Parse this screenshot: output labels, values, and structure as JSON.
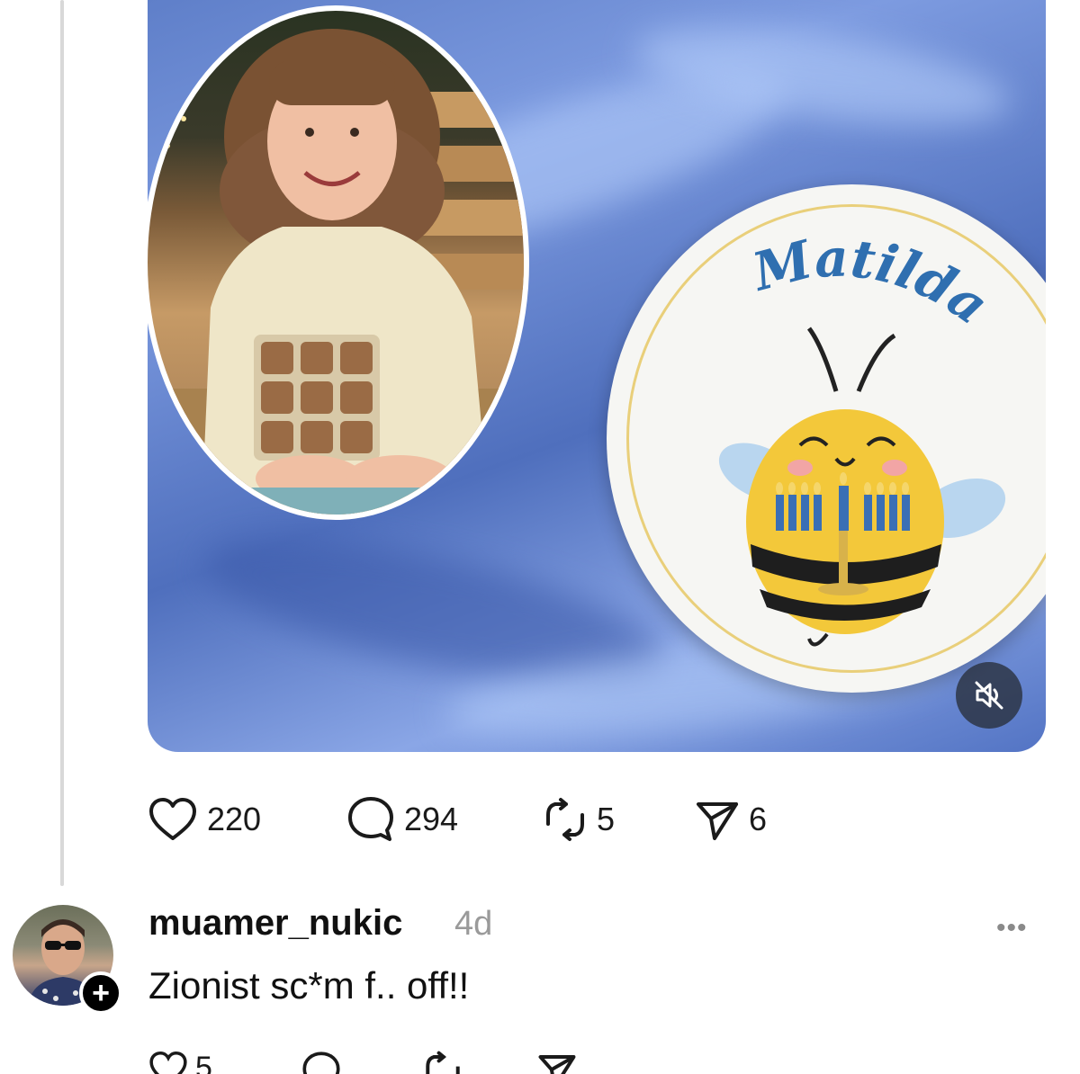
{
  "media": {
    "badge_name": "Matilda",
    "mute_icon": "speaker-muted-icon"
  },
  "actions": {
    "likes": "220",
    "comments": "294",
    "reposts": "5",
    "shares": "6"
  },
  "comment": {
    "username": "muamer_nukic",
    "time": "4d",
    "text": "Zionist sc*m f.. off!!",
    "follow_label": "+",
    "more_label": "•••",
    "likes": "5"
  },
  "colors": {
    "accent_blue": "#2f6fb0",
    "bee_yellow": "#f3c83a",
    "icon": "#1a1a1a",
    "muted_text": "#9a9a9a"
  }
}
